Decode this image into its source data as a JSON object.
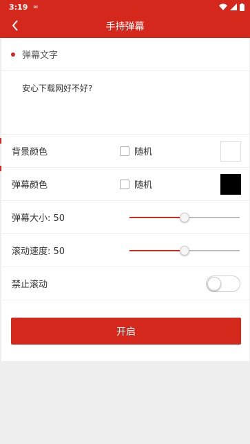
{
  "status_bar": {
    "time": "3:19",
    "notification_icon": "mail-icon"
  },
  "header": {
    "title": "手持弹幕",
    "back_icon": "chevron-left-icon"
  },
  "section": {
    "title": "弹幕文字"
  },
  "message": {
    "value": "安心下载网好不好?"
  },
  "rows": {
    "bg_color": {
      "label": "背景颜色",
      "random_label": "随机",
      "random_checked": false,
      "swatch_color": "#ffffff"
    },
    "danmaku_color": {
      "label": "弹幕颜色",
      "random_label": "随机",
      "random_checked": false,
      "swatch_color": "#000000"
    },
    "size": {
      "label": "弹幕大小: 50",
      "value": 50,
      "max": 100
    },
    "speed": {
      "label": "滚动速度: 50",
      "value": 50,
      "max": 100
    },
    "stop_scroll": {
      "label": "禁止滚动",
      "enabled": false
    }
  },
  "start_button": {
    "label": "开启"
  },
  "colors": {
    "accent": "#d5281c",
    "background": "#eeeeee",
    "panel": "#ffffff"
  }
}
